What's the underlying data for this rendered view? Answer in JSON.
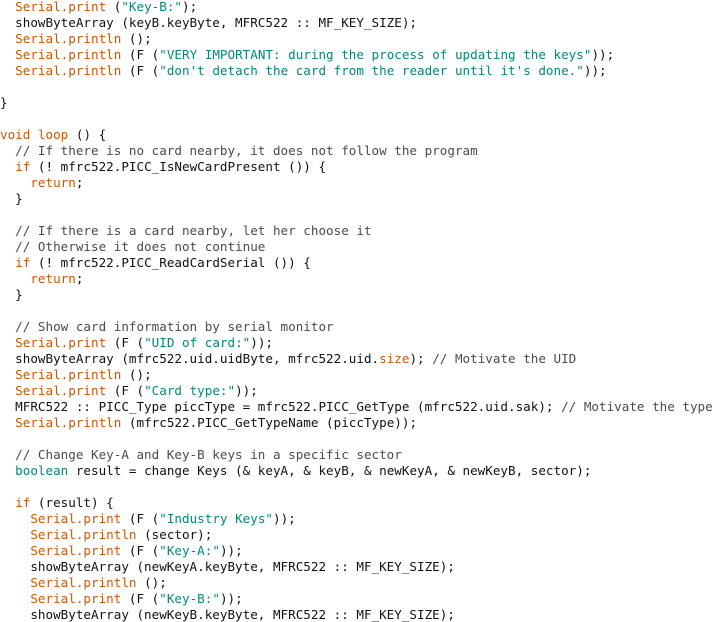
{
  "colors": {
    "plain": "#111111",
    "method": "#d35400",
    "string": "#00897b",
    "keyword": "#d35400",
    "type": "#00897b",
    "comment": "#4b4b4b",
    "background": "#ffffff"
  },
  "code_lines": [
    [
      [
        "  ",
        "plain"
      ],
      [
        "Serial.print",
        "method"
      ],
      [
        " (",
        "plain"
      ],
      [
        "\"Key-B:\"",
        "string"
      ],
      [
        ");",
        "plain"
      ]
    ],
    [
      [
        "  showByteArray (keyB.keyByte, MFRC522 :: MF_KEY_SIZE);",
        "plain"
      ]
    ],
    [
      [
        "  ",
        "plain"
      ],
      [
        "Serial.println",
        "method"
      ],
      [
        " ();",
        "plain"
      ]
    ],
    [
      [
        "  ",
        "plain"
      ],
      [
        "Serial.println",
        "method"
      ],
      [
        " (F (",
        "plain"
      ],
      [
        "\"VERY IMPORTANT: during the process of updating the keys\"",
        "string"
      ],
      [
        "));",
        "plain"
      ]
    ],
    [
      [
        "  ",
        "plain"
      ],
      [
        "Serial.println",
        "method"
      ],
      [
        " (F (",
        "plain"
      ],
      [
        "\"don't detach the card from the reader until it's done.\"",
        "string"
      ],
      [
        "));",
        "plain"
      ]
    ],
    [],
    [
      [
        "}",
        "plain"
      ]
    ],
    [],
    [
      [
        "void",
        "keyword"
      ],
      [
        " ",
        "plain"
      ],
      [
        "loop",
        "method"
      ],
      [
        " () {",
        "plain"
      ]
    ],
    [
      [
        "  // If there is no card nearby, it does not follow the program",
        "comment"
      ]
    ],
    [
      [
        "  ",
        "plain"
      ],
      [
        "if",
        "keyword"
      ],
      [
        " (! mfrc522.PICC_IsNewCardPresent ()) {",
        "plain"
      ]
    ],
    [
      [
        "    ",
        "plain"
      ],
      [
        "return",
        "keyword"
      ],
      [
        ";",
        "plain"
      ]
    ],
    [
      [
        "  }",
        "plain"
      ]
    ],
    [],
    [
      [
        "  // If there is a card nearby, let her choose it",
        "comment"
      ]
    ],
    [
      [
        "  // Otherwise it does not continue",
        "comment"
      ]
    ],
    [
      [
        "  ",
        "plain"
      ],
      [
        "if",
        "keyword"
      ],
      [
        " (! mfrc522.PICC_ReadCardSerial ()) {",
        "plain"
      ]
    ],
    [
      [
        "    ",
        "plain"
      ],
      [
        "return",
        "keyword"
      ],
      [
        ";",
        "plain"
      ]
    ],
    [
      [
        "  }",
        "plain"
      ]
    ],
    [],
    [
      [
        "  // Show card information by serial monitor",
        "comment"
      ]
    ],
    [
      [
        "  ",
        "plain"
      ],
      [
        "Serial.print",
        "method"
      ],
      [
        " (F (",
        "plain"
      ],
      [
        "\"UID of card:\"",
        "string"
      ],
      [
        "));",
        "plain"
      ]
    ],
    [
      [
        "  showByteArray (mfrc522.uid.uidByte, mfrc522.uid.",
        "plain"
      ],
      [
        "size",
        "method"
      ],
      [
        "); ",
        "plain"
      ],
      [
        "// Motivate the UID",
        "comment"
      ]
    ],
    [
      [
        "  ",
        "plain"
      ],
      [
        "Serial.println",
        "method"
      ],
      [
        " ();",
        "plain"
      ]
    ],
    [
      [
        "  ",
        "plain"
      ],
      [
        "Serial.print",
        "method"
      ],
      [
        " (F (",
        "plain"
      ],
      [
        "\"Card type:\"",
        "string"
      ],
      [
        "));",
        "plain"
      ]
    ],
    [
      [
        "  MFRC522 :: PICC_Type piccType = mfrc522.PICC_GetType (mfrc522.uid.sak); ",
        "plain"
      ],
      [
        "// Motivate the type",
        "comment"
      ]
    ],
    [
      [
        "  ",
        "plain"
      ],
      [
        "Serial.println",
        "method"
      ],
      [
        " (mfrc522.PICC_GetTypeName (piccType));",
        "plain"
      ]
    ],
    [],
    [
      [
        "  // Change Key-A and Key-B keys in a specific sector",
        "comment"
      ]
    ],
    [
      [
        "  ",
        "plain"
      ],
      [
        "boolean",
        "type"
      ],
      [
        " result = change Keys (& keyA, & keyB, & newKeyA, & newKeyB, sector);",
        "plain"
      ]
    ],
    [],
    [
      [
        "  ",
        "plain"
      ],
      [
        "if",
        "keyword"
      ],
      [
        " (result) {",
        "plain"
      ]
    ],
    [
      [
        "    ",
        "plain"
      ],
      [
        "Serial.print",
        "method"
      ],
      [
        " (F (",
        "plain"
      ],
      [
        "\"Industry Keys\"",
        "string"
      ],
      [
        "));",
        "plain"
      ]
    ],
    [
      [
        "    ",
        "plain"
      ],
      [
        "Serial.println",
        "method"
      ],
      [
        " (sector);",
        "plain"
      ]
    ],
    [
      [
        "    ",
        "plain"
      ],
      [
        "Serial.print",
        "method"
      ],
      [
        " (F (",
        "plain"
      ],
      [
        "\"Key-A:\"",
        "string"
      ],
      [
        "));",
        "plain"
      ]
    ],
    [
      [
        "    showByteArray (newKeyA.keyByte, MFRC522 :: MF_KEY_SIZE);",
        "plain"
      ]
    ],
    [
      [
        "    ",
        "plain"
      ],
      [
        "Serial.println",
        "method"
      ],
      [
        " ();",
        "plain"
      ]
    ],
    [
      [
        "    ",
        "plain"
      ],
      [
        "Serial.print",
        "method"
      ],
      [
        " (F (",
        "plain"
      ],
      [
        "\"Key-B:\"",
        "string"
      ],
      [
        "));",
        "plain"
      ]
    ],
    [
      [
        "    showByteArray (newKeyB.keyByte, MFRC522 :: MF_KEY_SIZE);",
        "plain"
      ]
    ]
  ]
}
